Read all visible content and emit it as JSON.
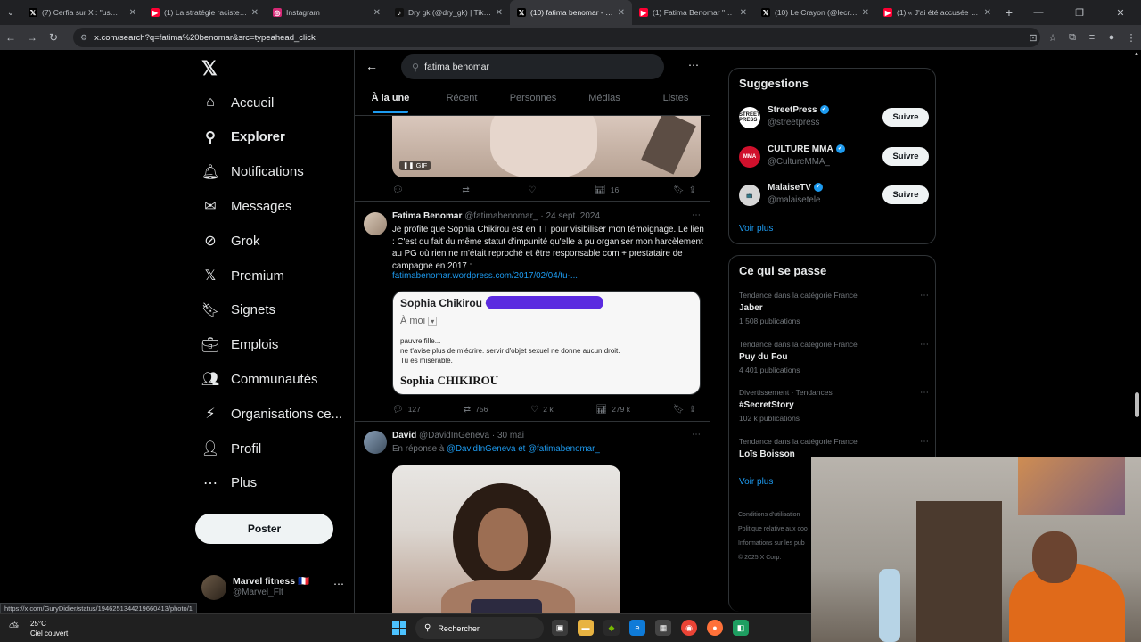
{
  "browser": {
    "tabs": [
      {
        "title": "(7) Cerfia sur X : \"us💔 Fi...",
        "icon": "x-icon",
        "color": "#000000"
      },
      {
        "title": "(1) La stratégie raciste - Y...",
        "icon": "youtube-icon",
        "color": "#ff0033"
      },
      {
        "title": "Instagram",
        "icon": "instagram-icon",
        "color": "#d62976"
      },
      {
        "title": "Dry gk (@dry_gk) | TikTok",
        "icon": "tiktok-icon",
        "color": "#111111"
      },
      {
        "title": "(10) fatima benomar - Re...",
        "icon": "x-icon",
        "color": "#000000"
      },
      {
        "title": "(1) Fatima Benomar \"Com...",
        "icon": "youtube-icon",
        "color": "#ff0033"
      },
      {
        "title": "(10) Le Crayon (@lecrayo...",
        "icon": "x-icon",
        "color": "#000000"
      },
      {
        "title": "(1) « J'ai été accusée d'av...",
        "icon": "youtube-icon",
        "color": "#ff0033"
      }
    ],
    "active_tab": 4,
    "url": "x.com/search?q=fatima%20benomar&src=typeahead_click",
    "status_url": "https://x.com/GuryDidier/status/1946251344219660413/photo/1"
  },
  "nav": {
    "items": [
      {
        "label": "Accueil",
        "icon": "home-icon",
        "glyph": "⌂"
      },
      {
        "label": "Explorer",
        "icon": "search-icon",
        "glyph": "⚲",
        "bold": true
      },
      {
        "label": "Notifications",
        "icon": "bell-icon",
        "glyph": "🔔︎",
        "badge": "7"
      },
      {
        "label": "Messages",
        "icon": "mail-icon",
        "glyph": "✉",
        "badge": "3"
      },
      {
        "label": "Grok",
        "icon": "grok-icon",
        "glyph": "⊘"
      },
      {
        "label": "Premium",
        "icon": "x-premium-icon",
        "glyph": "𝕏"
      },
      {
        "label": "Signets",
        "icon": "bookmark-icon",
        "glyph": "🔖︎"
      },
      {
        "label": "Emplois",
        "icon": "briefcase-icon",
        "glyph": "💼︎"
      },
      {
        "label": "Communautés",
        "icon": "people-icon",
        "glyph": "👥︎"
      },
      {
        "label": "Organisations ce...",
        "icon": "lightning-icon",
        "glyph": "⚡︎"
      },
      {
        "label": "Profil",
        "icon": "person-icon",
        "glyph": "👤︎"
      },
      {
        "label": "Plus",
        "icon": "more-circle-icon",
        "glyph": "⋯"
      }
    ],
    "post_label": "Poster",
    "account": {
      "name": "Marvel fitness 🇫🇷",
      "handle": "@Marvel_Flt"
    }
  },
  "search": {
    "query": "fatima benomar",
    "tabs": [
      "À la une",
      "Récent",
      "Personnes",
      "Médias",
      "Listes"
    ],
    "active_tab": 0
  },
  "tweets": [
    {
      "gif_label": "GIF",
      "actions": {
        "replies": "",
        "retweets": "",
        "likes": "",
        "views": "16"
      }
    },
    {
      "name": "Fatima Benomar",
      "handle": "@fatimabenomar_",
      "date": "· 24 sept. 2024",
      "text": "Je profite que Sophia Chikirou est en TT pour visibiliser mon témoignage. Le lien : C'est du fait du même statut d'impunité qu'elle a pu organiser mon harcèlement au PG où rien ne m'était reproché et être responsable com + prestataire de campagne en 2017 :",
      "link": "fatimabenomar.wordpress.com/2017/02/04/tu-...",
      "card": {
        "from": "Sophia Chikirou <",
        "to": "À moi",
        "body": [
          "pauvre fille...",
          "ne t'avise plus de m'écrire. servir d'objet sexuel ne donne aucun droit.",
          "Tu es misérable."
        ],
        "signature": "Sophia CHIKIROU"
      },
      "actions": {
        "replies": "127",
        "retweets": "756",
        "likes": "2 k",
        "views": "279 k"
      }
    },
    {
      "name": "David",
      "handle": "@DavidInGeneva",
      "date": "· 30 mai",
      "reply_prefix": "En réponse à",
      "reply_to": "@DavidInGeneva  et  @fatimabenomar_"
    }
  ],
  "suggestions": {
    "title": "Suggestions",
    "items": [
      {
        "name": "StreetPress",
        "handle": "@streetpress",
        "avatar_text": "STREET PRESS",
        "avatar_bg": "#ffffff",
        "avatar_fg": "#111111"
      },
      {
        "name": "CULTURE MMA",
        "handle": "@CultureMMA_",
        "avatar_text": "MMA",
        "avatar_bg": "#d0102c",
        "avatar_fg": "#ffffff"
      },
      {
        "name": "MalaiseTV",
        "handle": "@malaisetele",
        "avatar_text": "📺",
        "avatar_bg": "#d6d6d6",
        "avatar_fg": "#111111"
      }
    ],
    "follow_label": "Suivre",
    "more_label": "Voir plus"
  },
  "trends": {
    "title": "Ce qui se passe",
    "items": [
      {
        "context": "Tendance dans la catégorie France",
        "name": "Jaber",
        "posts": "1 508 publications"
      },
      {
        "context": "Tendance dans la catégorie France",
        "name": "Puy du Fou",
        "posts": "4 401 publications"
      },
      {
        "context": "Divertissement · Tendances",
        "name": "#SecretStory",
        "posts": "102 k publications"
      },
      {
        "context": "Tendance dans la catégorie France",
        "name": "Loïs Boisson",
        "posts": ""
      }
    ],
    "more_label": "Voir plus",
    "footer": [
      "Conditions d'utilisation",
      "Politique relative aux coo",
      "Informations sur les pub",
      "© 2025 X Corp."
    ]
  },
  "taskbar": {
    "temperature": "25°C",
    "weather": "Ciel couvert",
    "search_label": "Rechercher"
  },
  "colors": {
    "accent": "#1d9bf0",
    "background": "#000000",
    "border": "#2f3336"
  }
}
